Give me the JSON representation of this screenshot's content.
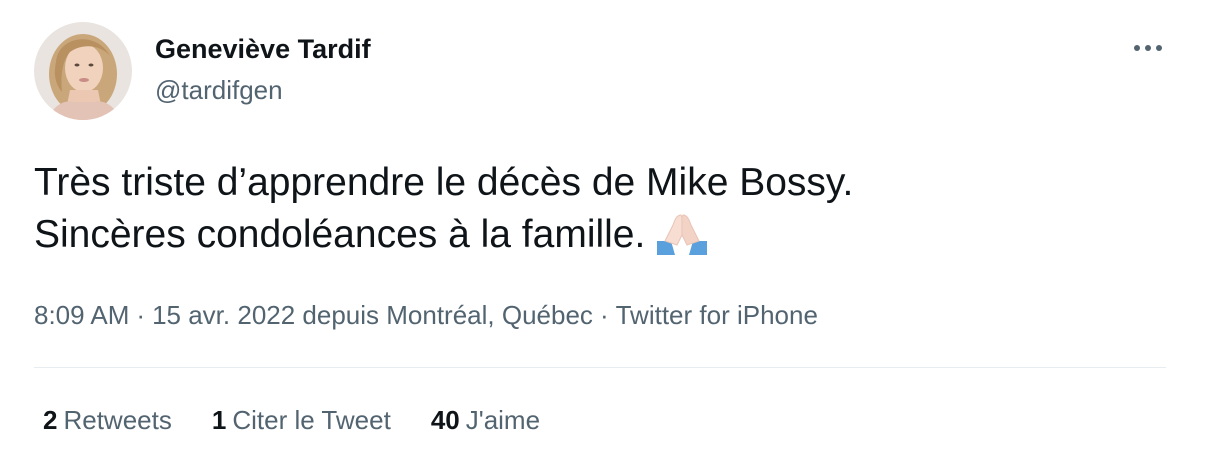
{
  "author": {
    "name": "Geneviève Tardif",
    "handle": "@tardifgen"
  },
  "tweet": {
    "line1": "Très triste d’apprendre le décès de Mike Bossy.",
    "line2": "Sincères condoléances à la famille.",
    "emoji_icon": "folded-hands-icon"
  },
  "meta": {
    "time": "8:09 AM",
    "date_location": "15 avr. 2022 depuis Montréal, Québec",
    "source": "Twitter for iPhone",
    "separator": "·"
  },
  "stats": {
    "retweets_count": "2",
    "retweets_label": "Retweets",
    "quotes_count": "1",
    "quotes_label": "Citer le Tweet",
    "likes_count": "40",
    "likes_label": "J'aime"
  },
  "more_icon": "more-horizontal-icon",
  "colors": {
    "text_primary": "#0f1419",
    "text_secondary": "#536471",
    "divider": "#e6ecf0"
  }
}
